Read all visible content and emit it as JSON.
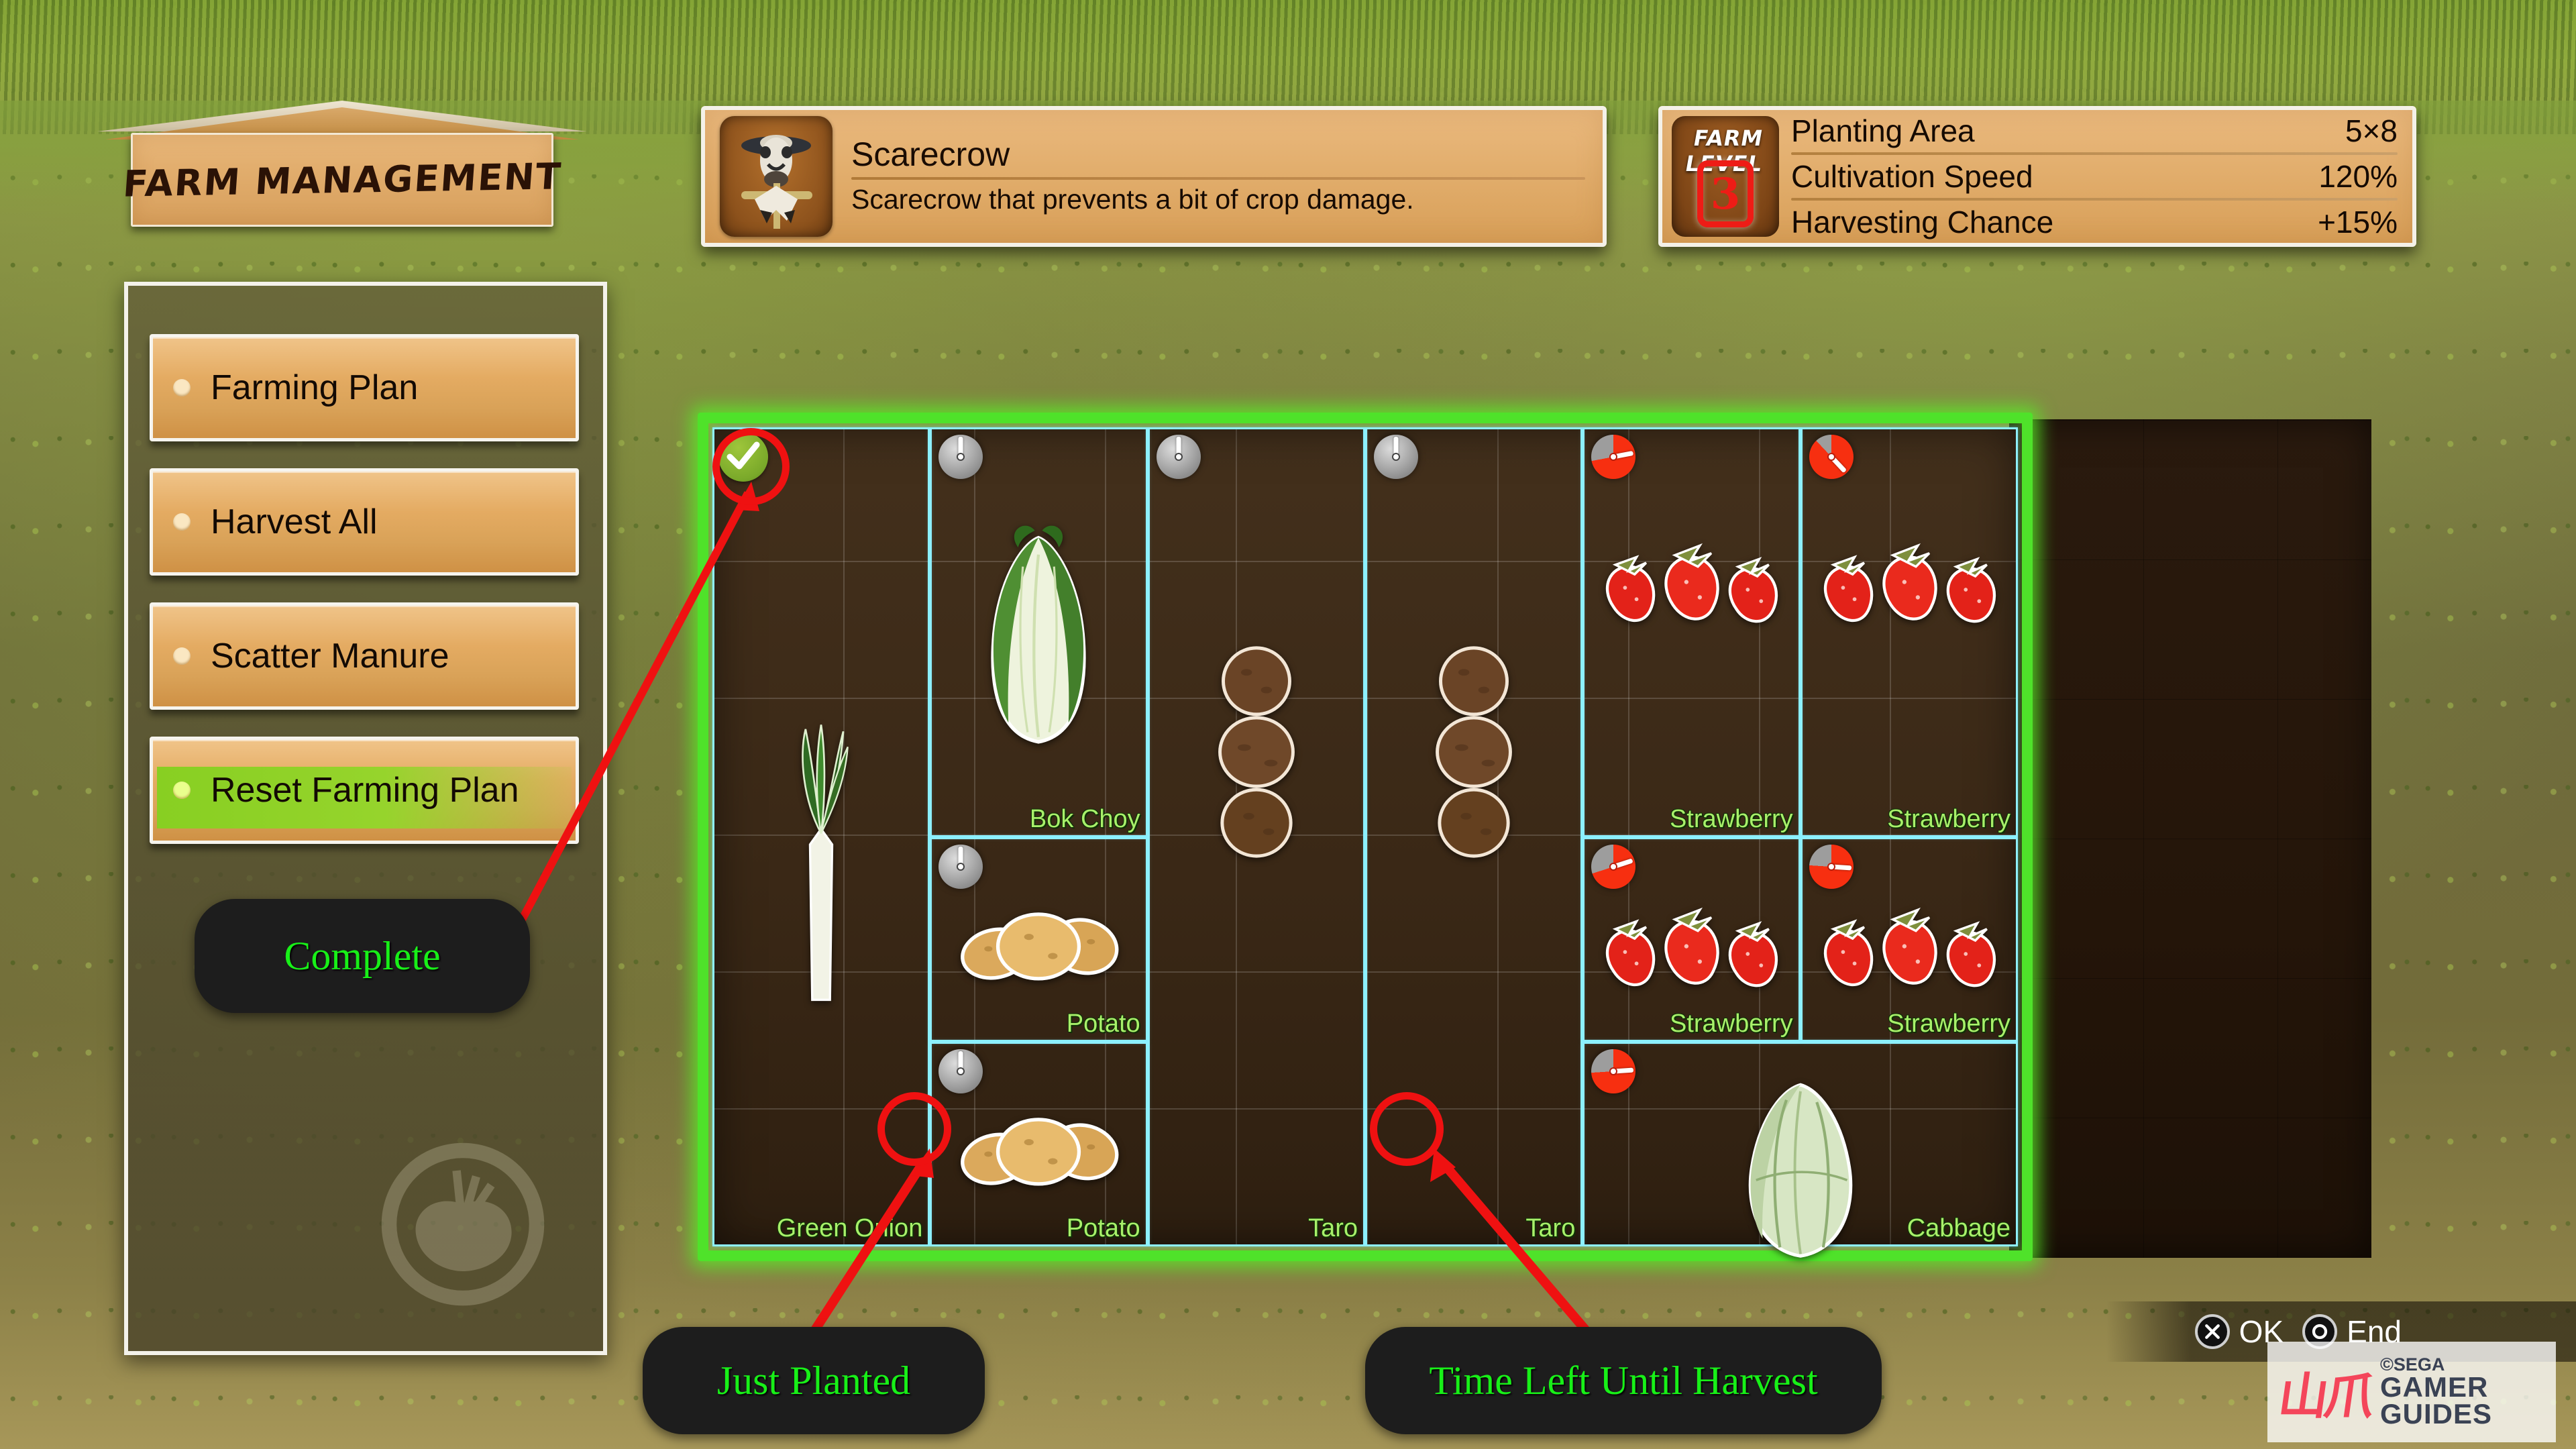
{
  "sign": {
    "title": "FARM MANAGEMENT"
  },
  "menu": {
    "items": [
      {
        "label": "Farming Plan",
        "selected": false
      },
      {
        "label": "Harvest All",
        "selected": false
      },
      {
        "label": "Scatter Manure",
        "selected": false
      },
      {
        "label": "Reset Farming Plan",
        "selected": true
      }
    ],
    "watermark_icon": "turnip-icon"
  },
  "item_card": {
    "icon": "scarecrow-icon",
    "title": "Scarecrow",
    "description": "Scarecrow that prevents a bit of crop damage."
  },
  "farm_level": {
    "heading": "FARM LEVEL",
    "level": "3",
    "stats": [
      {
        "label": "Planting Area",
        "value": "5×8"
      },
      {
        "label": "Cultivation Speed",
        "value": "120%"
      },
      {
        "label": "Harvesting Chance",
        "value": "+15%"
      }
    ]
  },
  "field": {
    "columns": 5,
    "rows": 4,
    "plots": [
      {
        "name": "Green Onion",
        "crop": "green-onion",
        "col": 0,
        "row": 0,
        "w": 1,
        "h": 4,
        "status": "complete",
        "progress": 100
      },
      {
        "name": "Bok Choy",
        "crop": "bok-choy",
        "col": 1,
        "row": 0,
        "w": 1,
        "h": 2,
        "status": "growing",
        "progress": 0
      },
      {
        "name": "Potato",
        "crop": "potato",
        "col": 1,
        "row": 2,
        "w": 1,
        "h": 1,
        "status": "growing",
        "progress": 0
      },
      {
        "name": "Potato",
        "crop": "potato",
        "col": 1,
        "row": 3,
        "w": 1,
        "h": 1,
        "status": "planted",
        "progress": 0
      },
      {
        "name": "Taro",
        "crop": "taro",
        "col": 2,
        "row": 0,
        "w": 1,
        "h": 4,
        "status": "growing",
        "progress": 0
      },
      {
        "name": "Taro",
        "crop": "taro",
        "col": 3,
        "row": 0,
        "w": 1,
        "h": 4,
        "status": "growing",
        "progress": 0
      },
      {
        "name": "Strawberry",
        "crop": "strawberry",
        "col": 4,
        "row": 0,
        "w": 1,
        "h": 2,
        "status": "timed",
        "progress": 72
      },
      {
        "name": "Strawberry",
        "crop": "strawberry",
        "col": 5,
        "row": 0,
        "w": 1,
        "h": 2,
        "status": "timed",
        "progress": 88
      },
      {
        "name": "Strawberry",
        "crop": "strawberry",
        "col": 4,
        "row": 2,
        "w": 1,
        "h": 1,
        "status": "timed",
        "progress": 70
      },
      {
        "name": "Strawberry",
        "crop": "strawberry",
        "col": 5,
        "row": 2,
        "w": 1,
        "h": 1,
        "status": "timed",
        "progress": 76
      },
      {
        "name": "Cabbage",
        "crop": "cabbage",
        "col": 4,
        "row": 3,
        "w": 2,
        "h": 1,
        "status": "timed",
        "progress": 74
      }
    ]
  },
  "annotations": [
    {
      "id": "complete",
      "text": "Complete"
    },
    {
      "id": "planted",
      "text": "Just Planted"
    },
    {
      "id": "harvest",
      "text": "Time Left Until Harvest"
    }
  ],
  "buttons": [
    {
      "glyph": "cross-icon",
      "label": "OK"
    },
    {
      "glyph": "circle-icon",
      "label": "End"
    }
  ],
  "watermark": {
    "copyright": "©SEGA",
    "line1": "GAMER",
    "line2": "GUIDES"
  }
}
